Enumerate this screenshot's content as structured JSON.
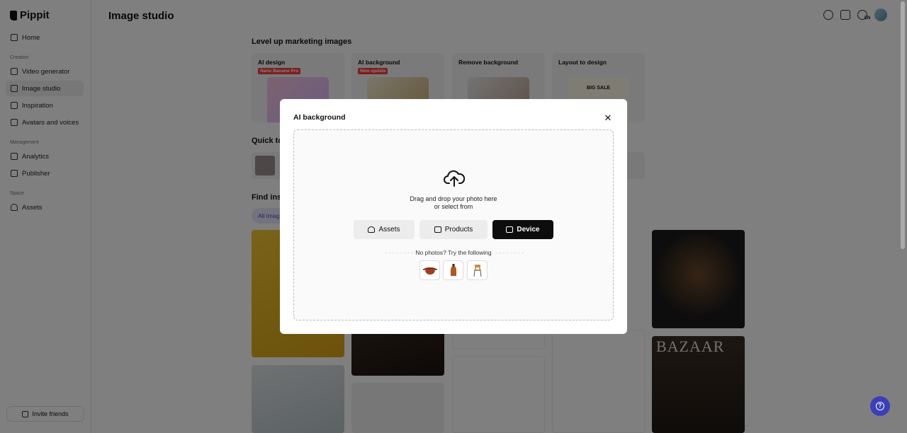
{
  "sidebar": {
    "brand": "Pippit",
    "items": [
      {
        "label": "Home"
      },
      {
        "label": "Video generator"
      },
      {
        "label": "Image studio"
      },
      {
        "label": "Inspiration"
      },
      {
        "label": "Avatars and voices"
      },
      {
        "label": "Analytics"
      },
      {
        "label": "Publisher"
      },
      {
        "label": "Assets"
      }
    ],
    "sections": {
      "creation": "Creation",
      "management": "Management",
      "space": "Space"
    },
    "invite_label": "Invite friends"
  },
  "header": {
    "title": "Image studio",
    "lang_badge": "EN"
  },
  "main": {
    "section1_title": "Level up marketing images",
    "cards": [
      {
        "title": "AI design",
        "tag": "Nano Banana Pro"
      },
      {
        "title": "AI background",
        "tag": "New update"
      },
      {
        "title": "Remove background",
        "tag": ""
      },
      {
        "title": "Layout to design",
        "tag": "",
        "thumb_text": "BIG SALE"
      }
    ],
    "quick_title": "Quick to",
    "find_title": "Find insp",
    "filter_pill": "All imag",
    "magazine_title": "BAZAAR"
  },
  "modal": {
    "title": "AI background",
    "drop_line1": "Drag and drop your photo here",
    "drop_line2": "or select from",
    "buttons": {
      "assets": "Assets",
      "products": "Products",
      "device": "Device"
    },
    "samples_label": "No photos? Try the following",
    "samples": [
      {
        "icon": "pot-icon"
      },
      {
        "icon": "bottle-icon"
      },
      {
        "icon": "chair-icon"
      }
    ]
  },
  "colors": {
    "accent": "#4b45c6",
    "tag_red": "#ff3b3b",
    "help_button": "#3b3fb8"
  }
}
